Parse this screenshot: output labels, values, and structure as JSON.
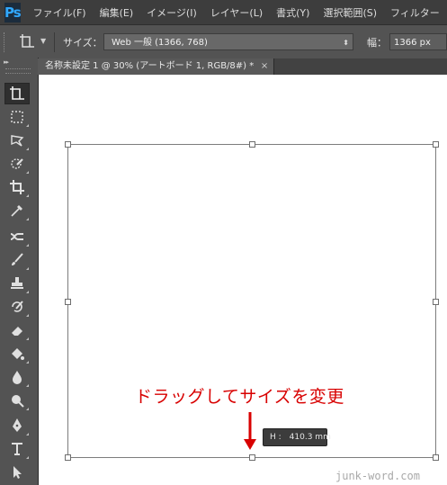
{
  "app": {
    "logo": "Ps"
  },
  "menubar": {
    "items": [
      "ファイル(F)",
      "編集(E)",
      "イメージ(I)",
      "レイヤー(L)",
      "書式(Y)",
      "選択範囲(S)",
      "フィルター"
    ]
  },
  "options": {
    "tool_icon": "artboard-tool-icon",
    "size_label": "サイズ：",
    "size_value": "Web 一般 (1366, 768)",
    "width_label": "幅：",
    "width_value": "1366 px"
  },
  "tab": {
    "title": "名称未設定 1 @ 30% (アートボード 1, RGB/8#) *",
    "close": "×"
  },
  "toolbar": {
    "collapse": "▸▸",
    "tools": [
      "artboard-tool-icon",
      "marquee-tool-icon",
      "lasso-tool-icon",
      "quick-select-tool-icon",
      "crop-tool-icon",
      "eyedropper-tool-icon",
      "healing-brush-tool-icon",
      "brush-tool-icon",
      "clone-stamp-tool-icon",
      "history-brush-tool-icon",
      "eraser-tool-icon",
      "paint-bucket-tool-icon",
      "blur-tool-icon",
      "dodge-tool-icon",
      "pen-tool-icon",
      "type-tool-icon",
      "path-select-tool-icon"
    ],
    "selected": "artboard-tool-icon"
  },
  "canvas": {
    "annotation": "ドラッグしてサイズを変更",
    "annotation_color": "#d80000",
    "tooltip_label": "H :",
    "tooltip_value": "410.3 mm",
    "watermark": "junk-word.com"
  }
}
